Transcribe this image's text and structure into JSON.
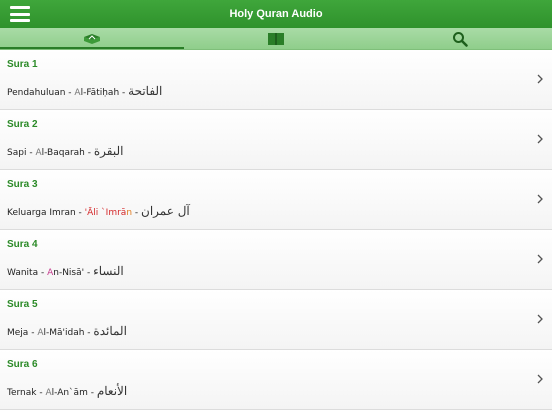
{
  "app": {
    "title": "Holy Quran Audio",
    "accent": "#2f922c",
    "tab_bg": "#a9dba6"
  },
  "tabs": [
    {
      "icon": "quran-book-icon",
      "active": true
    },
    {
      "icon": "open-book-icon",
      "active": false
    },
    {
      "icon": "search-icon",
      "active": false
    }
  ],
  "suras": [
    {
      "label": "Sura 1",
      "translation": "Pendahuluan",
      "separator": " - ",
      "translit_parts": [
        "A",
        "l-Fātiḥah"
      ],
      "arabic": "الفاتحة"
    },
    {
      "label": "Sura 2",
      "translation": "Sapi",
      "separator": " - ",
      "translit_parts": [
        "A",
        "l-Baqarah"
      ],
      "arabic": "البقرة"
    },
    {
      "label": "Sura 3",
      "translation": "Keluarga Imran",
      "separator": " - ",
      "translit_parts": [
        "'Āli `Imrā",
        "n"
      ],
      "arabic": "آل عمران"
    },
    {
      "label": "Sura 4",
      "translation": "Wanita",
      "separator": " - ",
      "translit_parts": [
        "A",
        "n-Nisā'"
      ],
      "arabic": "النساء"
    },
    {
      "label": "Sura 5",
      "translation": "Meja",
      "separator": " - ",
      "translit_parts": [
        "A",
        "l-Mā'idah"
      ],
      "arabic": "المائدة"
    },
    {
      "label": "Sura 6",
      "translation": "Ternak",
      "separator": " - ",
      "translit_parts": [
        "A",
        "l-An`ām"
      ],
      "arabic": "الأنعام"
    }
  ],
  "trailing_separator": " - "
}
